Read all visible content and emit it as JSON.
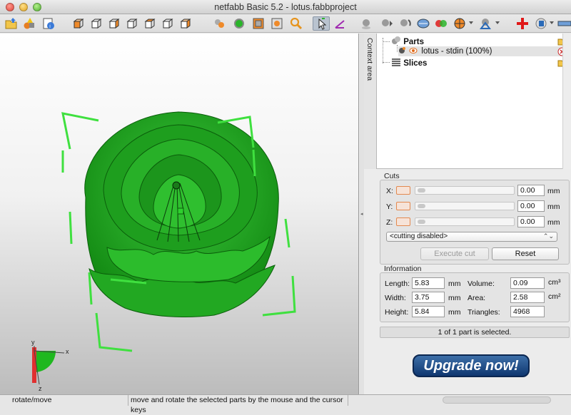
{
  "window": {
    "title": "netfabb Basic 5.2 - lotus.fabbproject"
  },
  "toolbar": {
    "icons": [
      "open-project-icon",
      "add-part-icon",
      "part-info-icon",
      "view-front-icon",
      "view-back-icon",
      "view-left-icon",
      "view-right-icon",
      "view-top-icon",
      "view-bottom-icon",
      "view-perspective-icon",
      "zoom-all-icon",
      "zoom-selection-icon",
      "zoom-window-icon",
      "zoom-icon",
      "select-mode-icon",
      "measure-mode-icon",
      "shading-icon",
      "move-part-icon",
      "rotate-part-icon",
      "repair-icon",
      "boolean-icon",
      "analysis-icon",
      "support-icon",
      "new-repair-icon",
      "export-icon",
      "ruler-icon"
    ]
  },
  "viewport": {
    "model_color": "#2ab52a",
    "selection_color": "#3fe03f",
    "axis_x_label": "x",
    "axis_y_label": "y",
    "axis_z_label": "z"
  },
  "context": {
    "tab_label": "Context area",
    "tree": {
      "parts_label": "Parts",
      "part_name": "lotus - stdin (100%)",
      "slices_label": "Slices"
    }
  },
  "cuts": {
    "title": "Cuts",
    "rows": [
      {
        "axis": "X:",
        "value": "0.00",
        "unit": "mm"
      },
      {
        "axis": "Y:",
        "value": "0.00",
        "unit": "mm"
      },
      {
        "axis": "Z:",
        "value": "0.00",
        "unit": "mm"
      }
    ],
    "mode": "<cutting disabled>",
    "execute_label": "Execute cut",
    "reset_label": "Reset"
  },
  "information": {
    "title": "Information",
    "length_label": "Length:",
    "length_value": "5.83",
    "length_unit": "mm",
    "width_label": "Width:",
    "width_value": "3.75",
    "width_unit": "mm",
    "height_label": "Height:",
    "height_value": "5.84",
    "height_unit": "mm",
    "volume_label": "Volume:",
    "volume_value": "0.09",
    "volume_unit": "cm³",
    "area_label": "Area:",
    "area_value": "2.58",
    "area_unit": "cm²",
    "triangles_label": "Triangles:",
    "triangles_value": "4968"
  },
  "selection_status": "1 of 1 part is selected.",
  "upgrade_label": "Upgrade now!",
  "statusbar": {
    "mode": "rotate/move",
    "hint": "move and rotate the selected parts by the mouse and the cursor keys"
  }
}
